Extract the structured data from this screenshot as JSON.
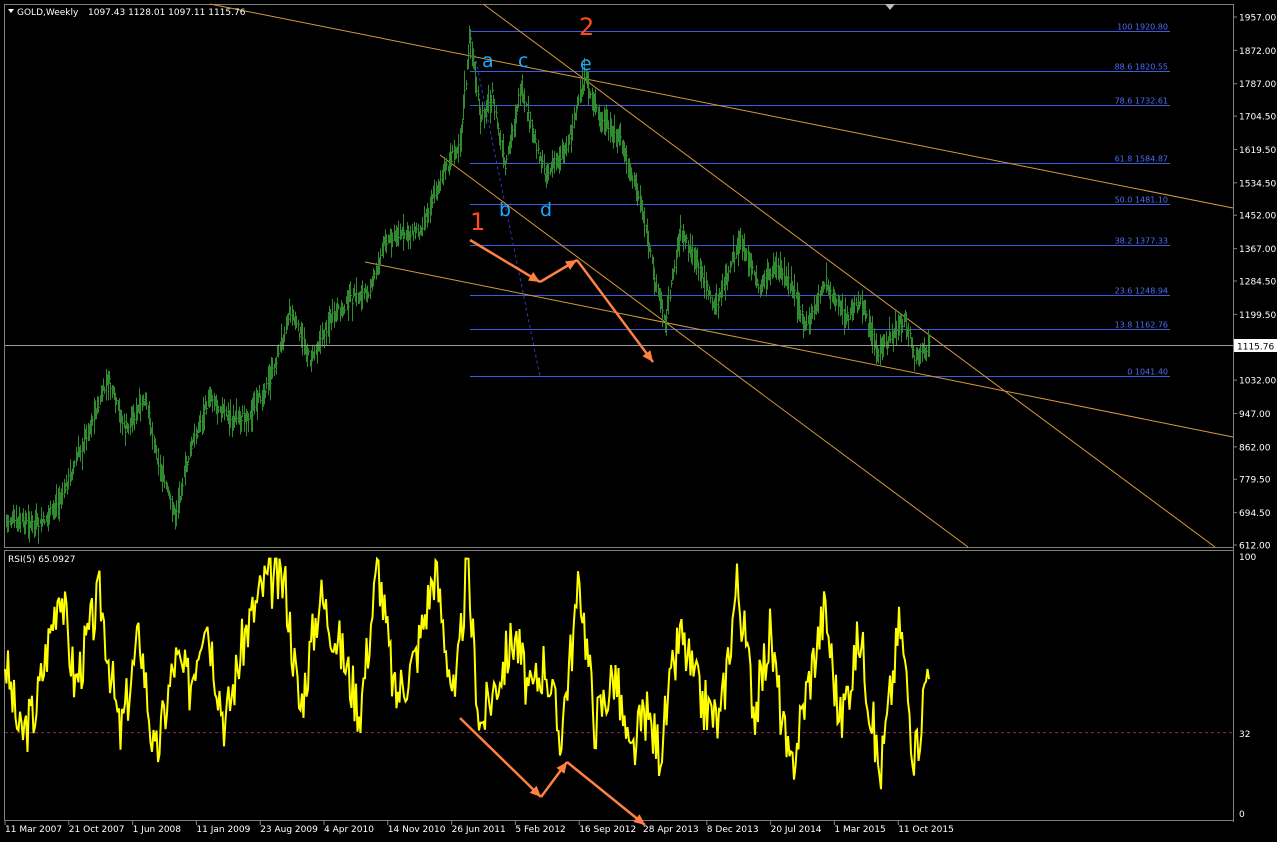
{
  "header": {
    "symbol_label": "GOLD,Weekly",
    "ohlc_label": "1097.43 1128.01 1097.11 1115.76"
  },
  "rsi": {
    "label": "RSI(5) 65.0927",
    "level_label": "32",
    "axis_labels": [
      "100",
      "32",
      "0"
    ]
  },
  "current_price_label": "1115.76",
  "wave_labels": {
    "one": "1",
    "two": "2",
    "a": "a",
    "b": "b",
    "c": "c",
    "d": "d",
    "e": "e"
  },
  "colors": {
    "background": "#000000",
    "bars": "#2e8b2e",
    "grid_frame": "#808080",
    "fib_lines": "#3c5ce0",
    "fib_text": "#4f6cf0",
    "trend_lines": "#d49a3a",
    "arrows": "#ff8040",
    "wave_red": "#ff4a1a",
    "wave_blue": "#1ea7ff",
    "rsi_line": "#ffff00",
    "rsi_level": "#8a2a5a",
    "axis_text": "#ffffff"
  },
  "chart_data": {
    "type": "line",
    "title": "GOLD,Weekly",
    "price_axis": {
      "ticks": [
        "1957.00",
        "1872.00",
        "1787.00",
        "1704.50",
        "1619.50",
        "1534.50",
        "1452.00",
        "1367.00",
        "1284.50",
        "1199.50",
        "1116.50",
        "1032.00",
        "947.00",
        "862.00",
        "779.50",
        "694.50",
        "612.00"
      ],
      "ylim": [
        612.0,
        1957.0
      ]
    },
    "time_axis": {
      "ticks": [
        "11 Mar 2007",
        "21 Oct 2007",
        "1 Jun 2008",
        "11 Jan 2009",
        "23 Aug 2009",
        "4 Apr 2010",
        "14 Nov 2010",
        "26 Jun 2011",
        "5 Feb 2012",
        "16 Sep 2012",
        "28 Apr 2013",
        "8 Dec 2013",
        "20 Jul 2014",
        "1 Mar 2015",
        "11 Oct 2015"
      ]
    },
    "series": [
      {
        "name": "GOLD,Weekly",
        "x": [
          "11 Mar 2007",
          "21 Oct 2007",
          "1 Jun 2008",
          "11 Jan 2009",
          "23 Aug 2009",
          "4 Apr 2010",
          "14 Nov 2010",
          "26 Jun 2011",
          "5 Feb 2012",
          "16 Sep 2012",
          "28 Apr 2013",
          "8 Dec 2013",
          "20 Jul 2014",
          "1 Mar 2015",
          "11 Oct 2015"
        ],
        "y": [
          660,
          800,
          890,
          900,
          950,
          1120,
          1380,
          1540,
          1750,
          1770,
          1450,
          1230,
          1300,
          1210,
          1090
        ]
      },
      {
        "name": "RSI(5)",
        "x": [
          "11 Mar 2007",
          "21 Oct 2007",
          "1 Jun 2008",
          "11 Jan 2009",
          "23 Aug 2009",
          "4 Apr 2010",
          "14 Nov 2010",
          "26 Jun 2011",
          "5 Feb 2012",
          "16 Sep 2012",
          "28 Apr 2013",
          "8 Dec 2013",
          "20 Jul 2014",
          "1 Mar 2015",
          "11 Oct 2015"
        ],
        "y": [
          55,
          60,
          48,
          60,
          55,
          62,
          58,
          45,
          40,
          60,
          25,
          45,
          50,
          45,
          65.09
        ]
      }
    ],
    "fibonacci": [
      {
        "level": "100",
        "price": "1920.80"
      },
      {
        "level": "88.6",
        "price": "1820.55"
      },
      {
        "level": "78.6",
        "price": "1732.61"
      },
      {
        "level": "61.8",
        "price": "1584.87"
      },
      {
        "level": "50.0",
        "price": "1481.10"
      },
      {
        "level": "38.2",
        "price": "1377.33"
      },
      {
        "level": "23.6",
        "price": "1248.94"
      },
      {
        "level": "13.8",
        "price": "1162.76"
      },
      {
        "level": "0",
        "price": "1041.40"
      }
    ],
    "current_price": 1115.76,
    "rsi_level": 32,
    "grid": false
  }
}
